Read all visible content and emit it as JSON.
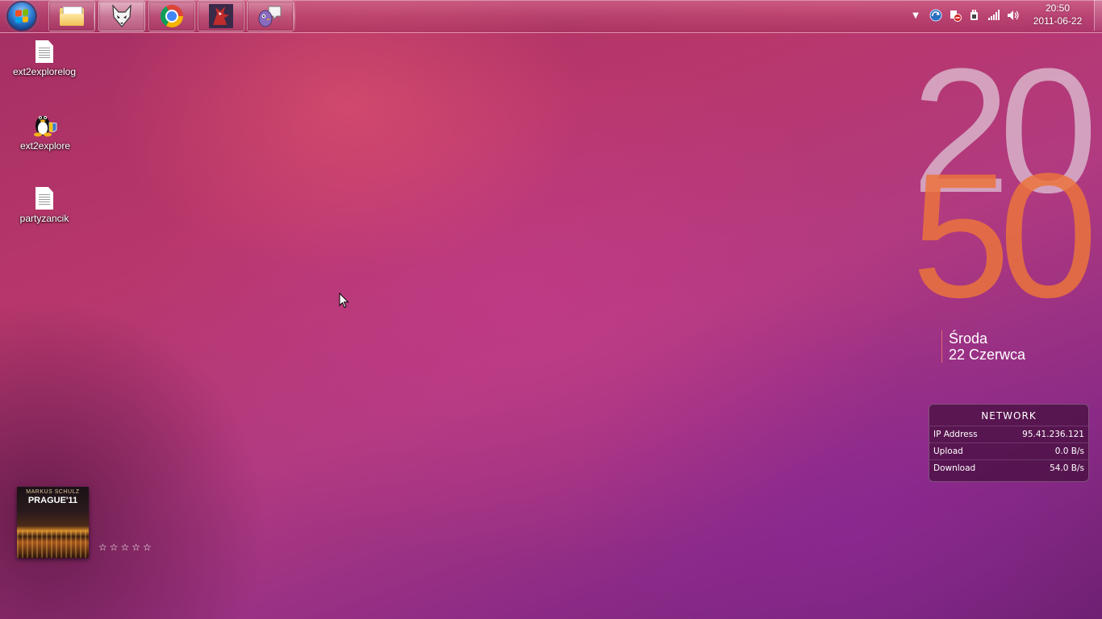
{
  "taskbar": {
    "clock": {
      "time": "20:50",
      "date": "2011-06-22"
    }
  },
  "desktop_icons": [
    {
      "label": "ext2explorelog",
      "icon": "text-file-icon"
    },
    {
      "label": "ext2explore",
      "icon": "tux-penguin-icon"
    },
    {
      "label": "partyzancik",
      "icon": "text-file-icon"
    }
  ],
  "clock_widget": {
    "hour": "20",
    "minute": "50",
    "weekday": "Środa",
    "date": "22 Czerwca",
    "colors": {
      "hour": "#e1cddc",
      "minute": "#eb733c"
    }
  },
  "network_widget": {
    "title": "NETWORK",
    "rows": [
      {
        "label": "IP Address",
        "value": "95.41.236.121"
      },
      {
        "label": "Upload",
        "value": "0.0 B/s"
      },
      {
        "label": "Download",
        "value": "54.0 B/s"
      }
    ]
  },
  "music_widget": {
    "artist": "MARKUS SCHULZ",
    "album": "PRAGUE'11",
    "stars": "☆☆☆☆☆",
    "rating": 0
  }
}
